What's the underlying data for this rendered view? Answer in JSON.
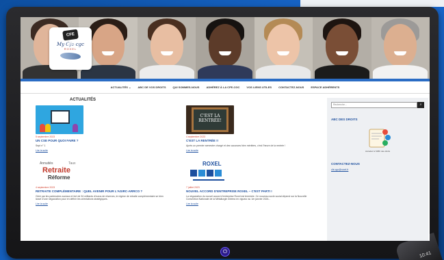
{
  "phone": {
    "time": "10:41"
  },
  "brand": {
    "badge": "CFE CGC",
    "name": "My Cfe-cgc",
    "sub": "ROXEL"
  },
  "nav": [
    "ACTUALITÉS ⌄",
    "ABC DE VOS DROITS",
    "QUI SOMMES-NOUS",
    "ADHÉREZ À LA CFE-CGC",
    "VOS LIENS UTILES",
    "CONTACTEZ-NOUS",
    "ESPACE ADHÉRENTS"
  ],
  "section_title": "ACTUALITÉS",
  "posts": [
    {
      "date": "5 septembre 2023",
      "title": "UN CSE POUR QUOI FAIRE ?",
      "excerpt": "Sept n° 1",
      "more": "Lire la suite"
    },
    {
      "date": "4 septembre 2023",
      "title": "C'EST LA RENTRÉE !!",
      "excerpt": "Après un premier semestre chargé et des vacances bien méritées, c'est l'heure de la rentrée !",
      "more": "Lire la suite",
      "thumb_text": "C'EST LA RENTRÉE!"
    },
    {
      "date": "4 septembre 2023",
      "title": "RETRAITE COMPLÉMENTAIRE : QUEL AVENIR POUR L'AGIRC-ARRCO ?",
      "excerpt": "Géré par les partenaires sociaux et fort de 94 milliards d'euros de réserves, le régime de retraite complémentaire se bien lancé d'une négociation pour en définir les orientations stratégiques.",
      "more": "Lire la suite",
      "thumb_words": [
        "Retraite",
        "Réforme",
        "Annuités",
        "Taux"
      ]
    },
    {
      "date": "7 juillet 2023",
      "title": "NOUVEL ACCORD D'ENTREPRISE ROXEL – C'EST PARTI !",
      "excerpt": "La négociation du nouvel accord d'entreprise Roxel est terminée. Ce nouveau socle social dépend sur la Nouvelle Convention Nationale de la Métallurgie entrera en vigueur au 1er janvier 2024...",
      "more": "Lire la suite",
      "thumb_text": "ROXEL"
    }
  ],
  "sidebar": {
    "search_placeholder": "Recherche...",
    "abc_title": "ABC DES DROITS",
    "abc_caption": "Accédez à l'ABC des droits",
    "contact_title": "CONTACTEZ-NOUS",
    "contact_link": "cfe.cgc@roxel.fr"
  },
  "colors": {
    "accent": "#1d4f9e",
    "date": "#d3422f",
    "stripe": "#2a6cc4"
  }
}
